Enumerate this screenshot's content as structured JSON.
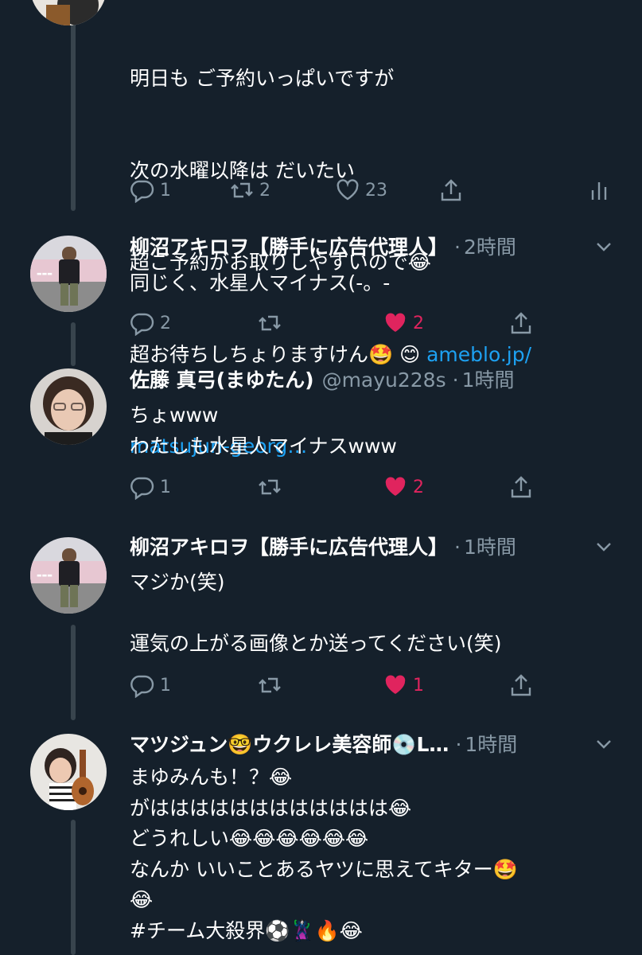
{
  "tweets": [
    {
      "body_lines": [
        "明日も ご予約いっぱいですが",
        "次の水曜以降は だいたい",
        "超ご予約がお取りしやすいので😂"
      ],
      "line4_text": "超お待ちしちょりますけん🤩 😊 ",
      "link_part1": "ameblo.jp/",
      "link_part2": "matsujun-georg…",
      "replies": "1",
      "retweets": "2",
      "likes": "23"
    },
    {
      "name": "柳沼アキロヲ【勝手に広告代理人】",
      "time": "2時間",
      "body": "同じく、水星人マイナス(-。-",
      "replies": "2",
      "retweets": "",
      "likes": "2"
    },
    {
      "name": "佐藤 真弓(まゆたん)",
      "handle": "@mayu228s",
      "time": "1時間",
      "body": "ちょwww\nわたしも水星人マイナスwww",
      "replies": "1",
      "retweets": "",
      "likes": "2"
    },
    {
      "name": "柳沼アキロヲ【勝手に広告代理人】",
      "time": "1時間",
      "body": "マジか(笑)\n\n運気の上がる画像とか送ってください(笑)",
      "replies": "1",
      "retweets": "",
      "likes": "1"
    },
    {
      "name": "マツジュン🤓ウクレレ美容師💿L…",
      "time": "1時間",
      "body": "まゆみんも！？😂\nがはははははははははははは😂\nどうれしい😂😂😂😂😂😂\nなんか いいことあるヤツに思えてキター🤩\n😂\n#チーム大殺界⚽️🦹‍♀️🔥😂"
    }
  ],
  "colors": {
    "background": "#15202b",
    "thread_line": "#38444d",
    "muted": "#8899a6",
    "link": "#1da1f2",
    "like": "#e0245e"
  },
  "icons": [
    "reply-icon",
    "retweet-icon",
    "like-icon",
    "share-icon",
    "analytics-icon",
    "chevron-down-icon"
  ]
}
